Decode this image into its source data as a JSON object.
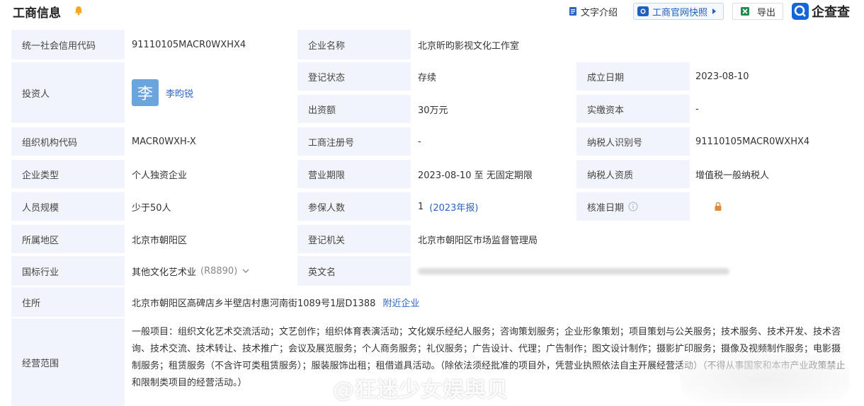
{
  "header": {
    "title": "工商信息",
    "text_intro": "文字介绍",
    "snapshot": "工商官网快照",
    "export": "导出",
    "brand": "企查查"
  },
  "rows": {
    "credit_code_label": "统一社会信用代码",
    "credit_code_value": "91110105MACR0WXHX4",
    "company_name_label": "企业名称",
    "company_name_value": "北京昕昀影视文化工作室",
    "investor_label": "投资人",
    "investor_avatar": "李",
    "investor_name": "李昀锐",
    "reg_status_label": "登记状态",
    "reg_status_value": "存续",
    "found_date_label": "成立日期",
    "found_date_value": "2023-08-10",
    "capital_label": "出资额",
    "capital_value": "30万元",
    "paid_capital_label": "实缴资本",
    "paid_capital_value": "-",
    "org_code_label": "组织机构代码",
    "org_code_value": "MACR0WXH-X",
    "biz_reg_label": "工商注册号",
    "biz_reg_value": "-",
    "taxpayer_id_label": "纳税人识别号",
    "taxpayer_id_value": "91110105MACR0WXHX4",
    "type_label": "企业类型",
    "type_value": "个人独资企业",
    "term_label": "营业期限",
    "term_value": "2023-08-10 至 无固定期限",
    "taxpayer_qual_label": "纳税人资质",
    "taxpayer_qual_value": "增值税一般纳税人",
    "staff_label": "人员规模",
    "staff_value": "少于50人",
    "insured_label": "参保人数",
    "insured_value": "1",
    "insured_year": "(2023年报)",
    "approve_label": "核准日期",
    "region_label": "所属地区",
    "region_value": "北京市朝阳区",
    "authority_label": "登记机关",
    "authority_value": "北京市朝阳区市场监督管理局",
    "industry_label": "国标行业",
    "industry_value": "其他文化艺术业",
    "industry_code": "(R8890)",
    "english_label": "英文名",
    "address_label": "住所",
    "address_value": "北京市朝阳区高碑店乡半壁店村惠河南街1089号1层D1388",
    "nearby_link": "附近企业",
    "scope_label": "经营范围",
    "scope_value": "一般项目：组织文化艺术交流活动；文艺创作；组织体育表演活动；文化娱乐经纪人服务；咨询策划服务；企业形象策划；项目策划与公关服务；技术服务、技术开发、技术咨询、技术交流、技术转让、技术推广；会议及展览服务；个人商务服务；礼仪服务；广告设计、代理；广告制作；图文设计制作；摄影扩印服务；摄像及视频制作服务；电影摄制服务；租赁服务（不含许可类租赁服务）；服装服饰出租；租借道具活动。（除依法须经批准的项目外，凭营业执照依法自主开展经营活动）（不得从事国家和本市产业政策禁止和限制类项目的经营活动。）"
  },
  "watermark": "@狂迷少女娱與贝"
}
